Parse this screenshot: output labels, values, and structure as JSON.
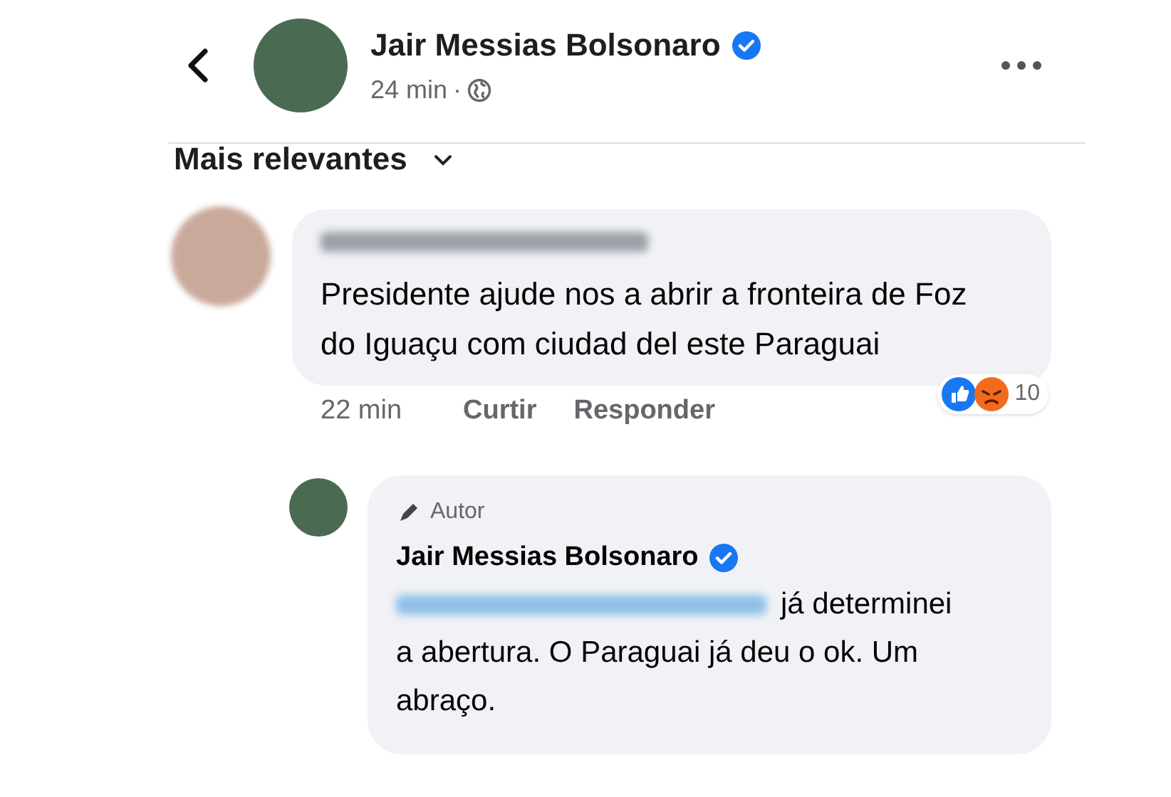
{
  "post_header": {
    "author": "Jair Messias Bolsonaro",
    "verified": true,
    "time": "24 min",
    "separator": "·"
  },
  "sort": {
    "label": "Mais relevantes"
  },
  "comments": [
    {
      "text": "Presidente ajude nos a abrir a fronteira de Foz do Iguaçu com ciudad del este Paraguai",
      "time": "22 min",
      "actions": [
        "Curtir",
        "Responder"
      ],
      "reaction_count": "10"
    }
  ],
  "reply": {
    "badge": "Autor",
    "author": "Jair Messias Bolsonaro",
    "verified": true,
    "text_after_mention": "já determinei",
    "text": "a abertura. O Paraguai já deu o ok. Um abraço."
  }
}
